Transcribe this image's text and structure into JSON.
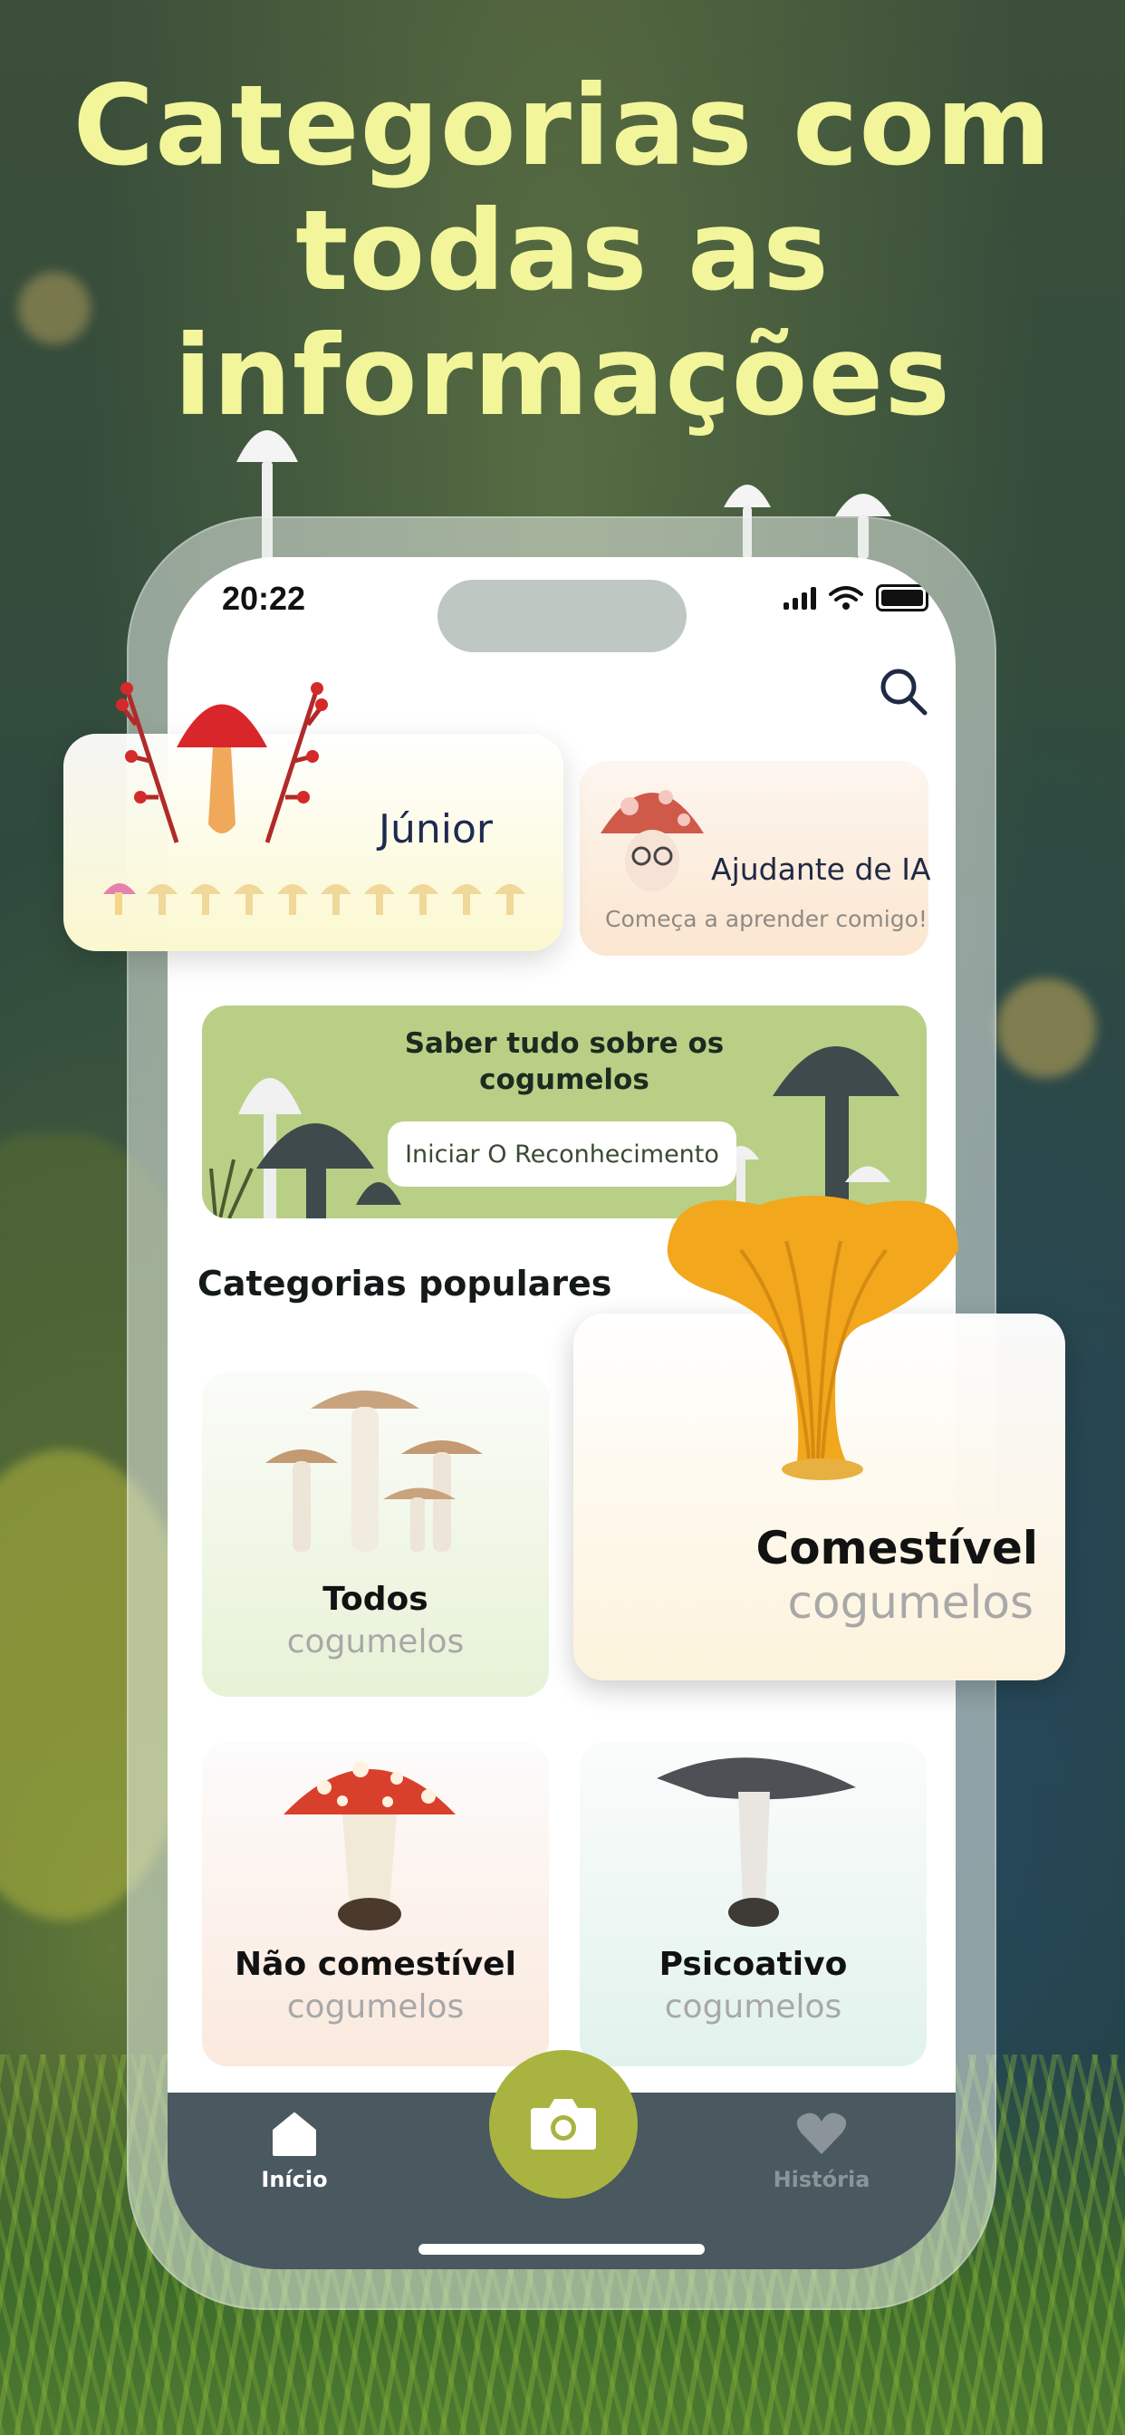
{
  "headline": "Categorias com todas as informações",
  "status": {
    "time": "20:22"
  },
  "junior": {
    "label": "Júnior"
  },
  "ai_helper": {
    "title": "Ajudante de IA",
    "subtitle": "Começa a aprender comigo!"
  },
  "banner": {
    "title": "Saber tudo sobre os cogumelos",
    "button_label": "Iniciar O Reconhecimento"
  },
  "section_title": "Categorias populares",
  "categories": [
    {
      "title": "Todos",
      "subtitle": "cogumelos"
    },
    {
      "title": "Comestível",
      "subtitle": "cogumelos"
    },
    {
      "title": "Não comestível",
      "subtitle": "cogumelos"
    },
    {
      "title": "Psicoativo",
      "subtitle": "cogumelos"
    }
  ],
  "tabs": {
    "home_label": "Início",
    "history_label": "História"
  },
  "colors": {
    "headline": "#f2f59a",
    "tabbar": "#4a5860",
    "camera_button": "#a8b43f",
    "banner": "#b9cf86"
  },
  "icons": {
    "search": "search-icon",
    "home": "home-icon",
    "camera": "camera-icon",
    "history": "heart-icon"
  }
}
